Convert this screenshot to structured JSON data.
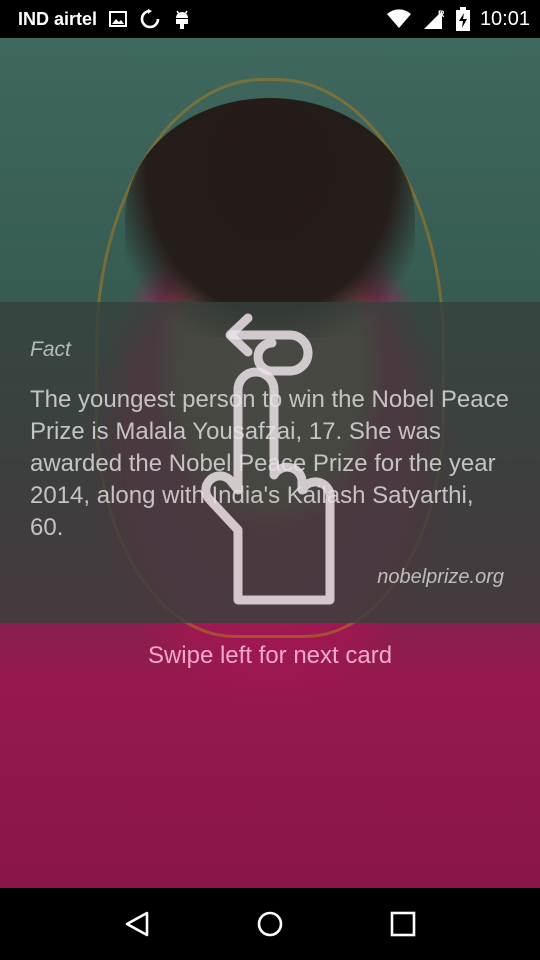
{
  "status_bar": {
    "carrier": "IND airtel",
    "clock": "10:01",
    "icons": [
      "image-icon",
      "sync-icon",
      "android-icon",
      "wifi-icon",
      "signal-roaming-icon",
      "battery-charging-icon"
    ]
  },
  "card": {
    "label": "Fact",
    "text": "The youngest person to win the Nobel Peace Prize is Malala Yousafzai, 17. She was awarded the Nobel Peace Prize for the year 2014, along with India's Kailash Satyarthi, 60.",
    "source": "nobelprize.org"
  },
  "hint": {
    "text": "Swipe left for next card"
  },
  "nav": {
    "icons": [
      "back-icon",
      "home-icon",
      "recents-icon"
    ]
  },
  "colors": {
    "hint": "#f2a9c6",
    "card_overlay": "#37413c",
    "scarf": "#c31d63",
    "background_top": "#4d7f73"
  }
}
